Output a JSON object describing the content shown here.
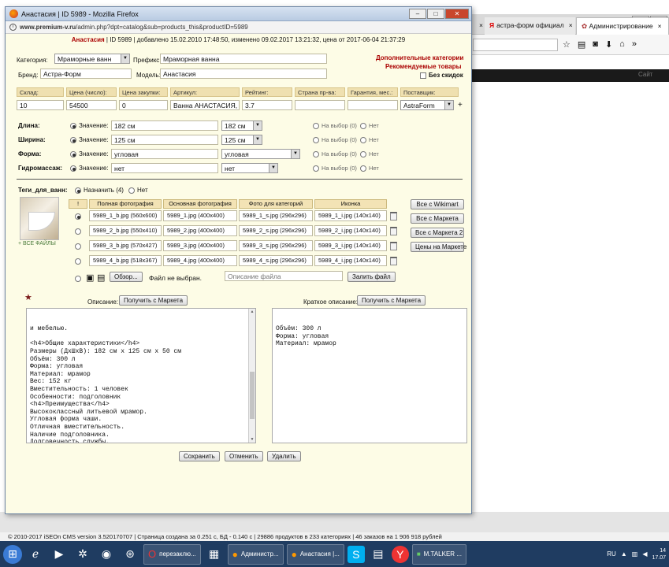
{
  "background": {
    "tabs": [
      {
        "label": "астра-форм официал"
      },
      {
        "label": "Администрирование"
      }
    ],
    "dark_bar_button": "Сайт",
    "footer": "© 2010-2017 iSEOn CMS version 3.520170707 | Страница создана за 0.251 с, БД - 0.140 с | 29886 продуктов в 233 категориях | 46 заказов на 1 906 918 рублей"
  },
  "window": {
    "title": "Анастасия | ID 5989 - Mozilla Firefox",
    "url_host": "www.premium-v.ru",
    "url_path": "/admin.php?dpt=catalog&sub=products_this&productID=5989"
  },
  "header": {
    "name": "Анастасия",
    "meta": " | ID 5989 | добавлено 15.02.2010 17:48:50, изменено 09.02.2017 13:21:32, цена от 2017-06-04 21:37:29"
  },
  "category": {
    "label": "Категория:",
    "value": "Мраморные ванн",
    "prefix_label": "Префикс:",
    "prefix_value": "Мраморная ванна"
  },
  "links": {
    "extra_categories": "Дополнительные категории",
    "recommended": "Рекомендуемые товары",
    "no_discount": "Без скидок"
  },
  "brand": {
    "label": "Бренд:",
    "value": "Астра-Форм",
    "model_label": "Модель:",
    "model_value": "Анастасия"
  },
  "stock_headers": [
    "Склад:",
    "Цена (число):",
    "Цена закупки:",
    "Артикул:",
    "Рейтинг:",
    "Страна пр-ва:",
    "Гарантия, мес.:",
    "Поставщик:"
  ],
  "stock_values": [
    "10",
    "54500",
    "0",
    "Ванна АНАСТАСИЯ,",
    "3.7",
    "",
    "",
    "AstraForm"
  ],
  "supplier_plus": "+",
  "params": [
    {
      "label": "Длина:",
      "value_label": "Значение:",
      "value": "182 см",
      "select": "182 см",
      "on_choice": "На выбор (0)",
      "no": "Нет"
    },
    {
      "label": "Ширина:",
      "value_label": "Значение:",
      "value": "125 см",
      "select": "125 см",
      "on_choice": "На выбор (0)",
      "no": "Нет"
    },
    {
      "label": "Форма:",
      "value_label": "Значение:",
      "value": "угловая",
      "select": "угловая",
      "on_choice": "На выбор (0)",
      "no": "Нет"
    },
    {
      "label": "Гидромассаж:",
      "value_label": "Значение:",
      "value": "нет",
      "select": "нет",
      "on_choice": "На выбор (0)",
      "no": "Нет"
    }
  ],
  "tags": {
    "label": "Теги_для_ванн:",
    "assign": "Назначить (4)",
    "no": "Нет"
  },
  "photos": {
    "all_files": "+ ВСЕ ФАЙЛЫ",
    "headers": [
      "!",
      "Полная фотография",
      "Основная фотография",
      "Фото для категорий",
      "Иконка"
    ],
    "rows": [
      [
        "5989_1_b.jpg (560x600)",
        "5989_1.jpg (400x400)",
        "5989_1_s.jpg (296x296)",
        "5989_1_i.jpg (140x140)"
      ],
      [
        "5989_2_b.jpg (550x410)",
        "5989_2.jpg (400x400)",
        "5989_2_s.jpg (296x296)",
        "5989_2_i.jpg (140x140)"
      ],
      [
        "5989_3_b.jpg (570x427)",
        "5989_3.jpg (400x400)",
        "5989_3_s.jpg (296x296)",
        "5989_3_i.jpg (140x140)"
      ],
      [
        "5989_4_b.jpg (518x367)",
        "5989_4.jpg (400x400)",
        "5989_4_s.jpg (296x296)",
        "5989_4_i.jpg (140x140)"
      ]
    ],
    "browse": "Обзор...",
    "no_file": "Файл не выбран.",
    "file_desc_placeholder": "Описание файла",
    "upload": "Залить файл",
    "side_buttons": [
      "Все с Wikimart",
      "Все с Маркета",
      "Все с Маркета 2",
      "Цены на Маркете"
    ]
  },
  "description": {
    "label": "Описание:",
    "get_market": "Получить с Маркета",
    "text": "и мебелью.\n\n<h4>Общие характеристики</h4>\nРазмеры (ДхШхВ): 182 см x 125 см x 50 см\nОбъём: 300 л\nФорма: угловая\nМатериал: мрамор\nВес: 152 кг\nВместительность: 1 человек\nОсобенности: подголовник\n<h4>Преимущества</h4>\nВысококлассный литьевой мрамор.\nУгловая форма чаши.\nОтличная вместительность.\nНаличие подголовника.\nДолговечность службы."
  },
  "short_description": {
    "label": "Краткое описание:",
    "get_market": "Получить с Маркета",
    "text": "Объём: 300 л\nФорма: угловая\nМатериал: мрамор"
  },
  "actions": {
    "save": "Сохранить",
    "cancel": "Отменить",
    "delete": "Удалить"
  },
  "taskbar": {
    "items": [
      "перезаклю...",
      "Администр...",
      "Анастасия |...",
      "M.TALKER ..."
    ],
    "lang": "RU",
    "time": "14",
    "date": "17.07"
  }
}
